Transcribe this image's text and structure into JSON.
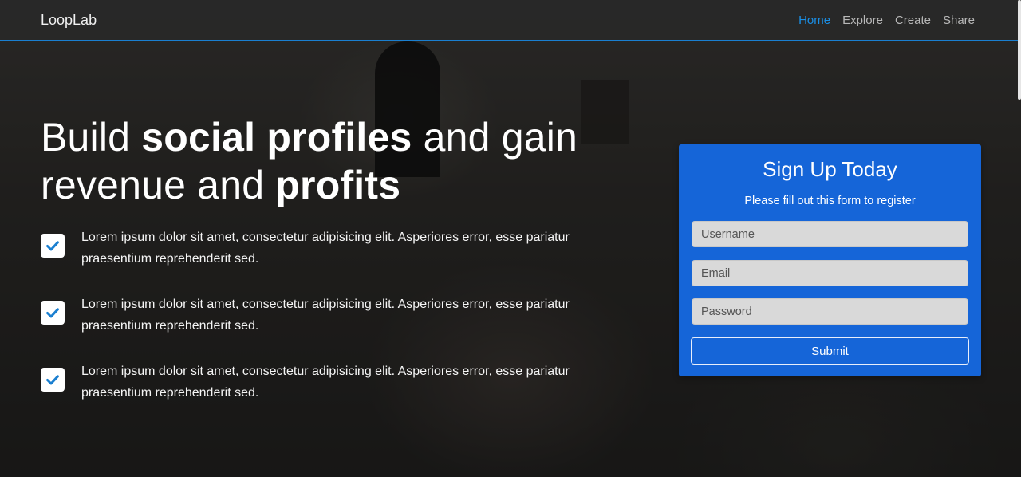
{
  "navbar": {
    "brand": "LoopLab",
    "links": [
      {
        "label": "Home",
        "active": true
      },
      {
        "label": "Explore",
        "active": false
      },
      {
        "label": "Create",
        "active": false
      },
      {
        "label": "Share",
        "active": false
      }
    ],
    "accent_color": "#1a8fe6"
  },
  "hero": {
    "headline_parts": {
      "p1": "Build ",
      "b1": "social profiles",
      "p2": " and gain revenue and ",
      "b2": "profits"
    },
    "features": [
      {
        "icon": "check-icon",
        "text": "Lorem ipsum dolor sit amet, consectetur adipisicing elit. Asperiores error, esse pariatur praesentium reprehenderit sed."
      },
      {
        "icon": "check-icon",
        "text": "Lorem ipsum dolor sit amet, consectetur adipisicing elit. Asperiores error, esse pariatur praesentium reprehenderit sed."
      },
      {
        "icon": "check-icon",
        "text": "Lorem ipsum dolor sit amet, consectetur adipisicing elit. Asperiores error, esse pariatur praesentium reprehenderit sed."
      }
    ],
    "check_color": "#1a7fd0"
  },
  "signup": {
    "title": "Sign Up Today",
    "subtitle": "Please fill out this form to register",
    "username_placeholder": "Username",
    "email_placeholder": "Email",
    "password_placeholder": "Password",
    "submit_label": "Submit",
    "card_color": "#1565d8"
  }
}
